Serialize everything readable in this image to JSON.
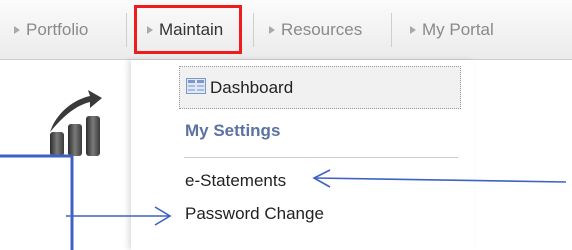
{
  "nav": {
    "tabs": [
      {
        "label": "Portfolio"
      },
      {
        "label": "Maintain"
      },
      {
        "label": "Resources"
      },
      {
        "label": "My Portal"
      }
    ]
  },
  "dropdown": {
    "dashboard_label": "Dashboard",
    "settings_heading": "My Settings",
    "items": [
      {
        "label": "e-Statements"
      },
      {
        "label": "Password Change"
      }
    ]
  },
  "colors": {
    "highlight_box": "#ee1c1c",
    "annotation": "#3e62c4",
    "heading": "#5a73a2"
  },
  "icons": [
    "bar-chart-arrow-icon",
    "dashboard-icon",
    "caret-right-icon"
  ]
}
